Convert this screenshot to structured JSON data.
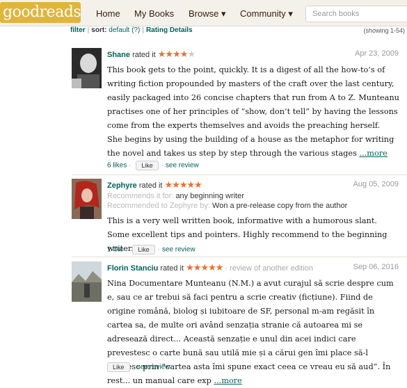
{
  "header": {
    "logo": "goodreads",
    "nav": [
      "Home",
      "My Books",
      "Browse ▾",
      "Community ▾"
    ],
    "search_placeholder": "Search books"
  },
  "filters": {
    "filter": "filter",
    "sort_label": "sort:",
    "sort_value": "default (?)",
    "rating_details": "Rating Details",
    "showing": "(showing 1-54)"
  },
  "reviews": [
    {
      "name": "Shane",
      "action": "rated it",
      "stars_on": "★★★★",
      "stars_off": "★",
      "rating": 4,
      "date": "Apr 23, 2009",
      "text1": "This book gets to the point, quickly. It is a digest of all the how-to’s of writing fiction propounded by masters of the craft over the last century, easily packaged into 26 concise chapters that run from A to Z. Munteanu practises one of her principles of “show, don’t tell” by having the lessons come from the experts themselves and avoids the preaching herself.",
      "text2": "She begins by using the building of a house as the metaphor for writing the novel and takes us step by step through the various stages",
      "more": "...more",
      "likes": "6 likes",
      "like_btn": "Like",
      "see_review": "see review"
    },
    {
      "name": "Zephyre",
      "action": "rated it",
      "stars_on": "★★★★★",
      "rating": 5,
      "date": "Aug 05, 2009",
      "rec_for_label": "Recommends it for:",
      "rec_for_value": "any beginning writer",
      "rec_to_label": "Recommended to Zephyre by:",
      "rec_to_value": "Won a pre-release copy from the author",
      "text1": "This is a very well written book, informative with a humorous slant. Some excellent tips and pointers. Highly recommend to the beginning writer.",
      "likes": "1 like",
      "like_btn": "Like",
      "see_review": "see review"
    },
    {
      "name": "Florin Stanciu",
      "action": "rated it",
      "stars_on": "★★★★★",
      "rating": 5,
      "note": "review of another edition",
      "date": "Sep 06, 2016",
      "text1": "Nina Documentare Munteanu (N.M.) a avut curajul să scrie despre cum e, sau ce ar trebui să faci pentru a scrie creativ (ficțiune). Fiind de origine română, biolog și iubitoare de SF, personal m-am regăsit în cartea sa, de multe ori având senzația stranie că autoarea mi se adresează direct... Această senzație e unul din acei indici care prevestesc o carte bună sau utilă mie și a cărui gen îmi place să-l definesc prin “cartea asta îmi spune exact ceea ce vreau eu să aud“. În rest... un manual care exp",
      "more": "...more",
      "like_btn": "Like",
      "see_review": "see review"
    }
  ]
}
